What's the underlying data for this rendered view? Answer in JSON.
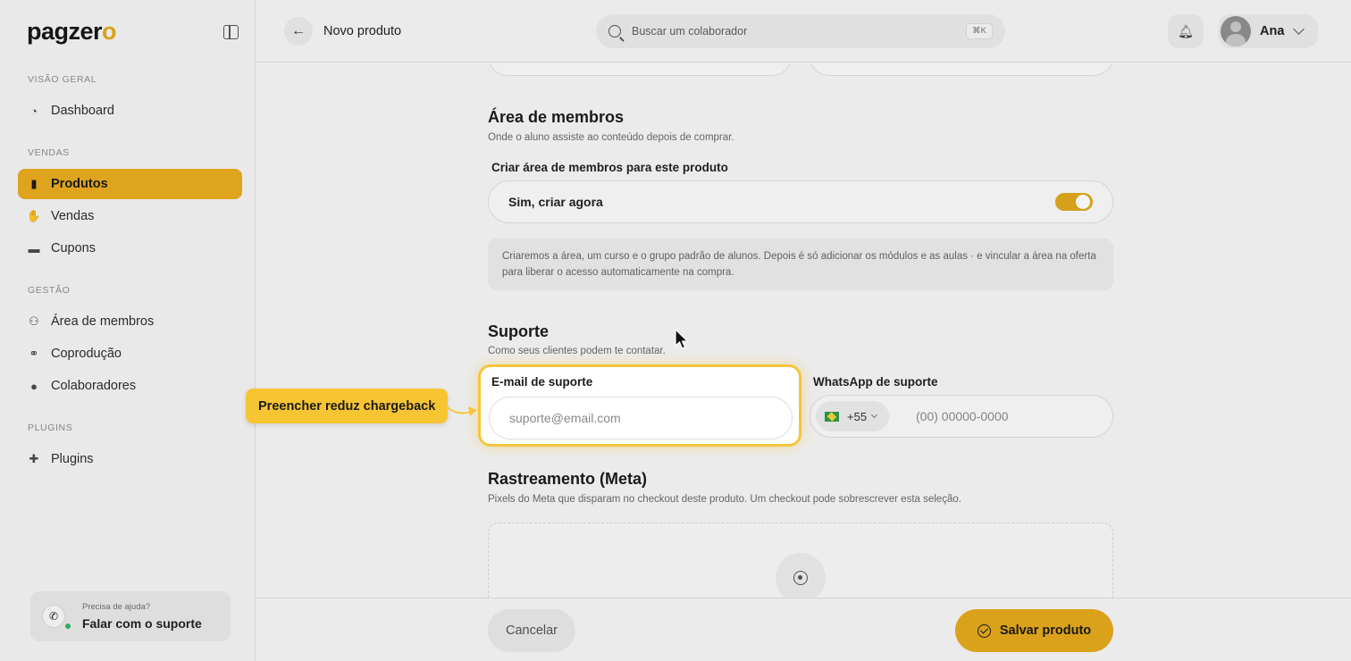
{
  "app": {
    "logo_text": "pagzer",
    "logo_accent": "o"
  },
  "sidebar": {
    "sections": [
      {
        "label": "VISÃO GERAL"
      },
      {
        "label": "VENDAS"
      },
      {
        "label": "GESTÃO"
      },
      {
        "label": "PLUGINS"
      }
    ],
    "items": [
      {
        "label": "Dashboard",
        "icon": "pie-chart-icon"
      },
      {
        "label": "Produtos",
        "icon": "box-icon",
        "active": true
      },
      {
        "label": "Vendas",
        "icon": "hand-money-icon"
      },
      {
        "label": "Cupons",
        "icon": "ticket-icon"
      },
      {
        "label": "Área de membros",
        "icon": "users-icon"
      },
      {
        "label": "Coprodução",
        "icon": "handshake-icon"
      },
      {
        "label": "Colaboradores",
        "icon": "user-icon"
      },
      {
        "label": "Plugins",
        "icon": "puzzle-icon"
      }
    ],
    "help": {
      "small": "Precisa de ajuda?",
      "title": "Falar com o suporte",
      "icon": "whatsapp-icon"
    }
  },
  "header": {
    "page_title": "Novo produto",
    "search_placeholder": "Buscar um colaborador",
    "search_shortcut": "⌘K",
    "user_name": "Ana"
  },
  "members": {
    "title": "Área de membros",
    "subtitle": "Onde o aluno assiste ao conteúdo depois de comprar.",
    "toggle_label": "Criar área de membros para este produto",
    "toggle_value": "Sim, criar agora",
    "toggle_on": true,
    "info": "Criaremos a área, um curso e o grupo padrão de alunos. Depois é só adicionar os módulos e as aulas · e vincular a área na oferta para liberar o acesso automaticamente na compra."
  },
  "support": {
    "title": "Suporte",
    "subtitle": "Como seus clientes podem te contatar.",
    "email_label": "E-mail de suporte",
    "email_placeholder": "suporte@email.com",
    "whatsapp_label": "WhatsApp de suporte",
    "country_code": "+55",
    "phone_placeholder": "(00) 00000-0000"
  },
  "tracking": {
    "title": "Rastreamento (Meta)",
    "subtitle": "Pixels do Meta que disparam no checkout deste produto. Um checkout pode sobrescrever esta seleção."
  },
  "footer": {
    "cancel": "Cancelar",
    "save": "Salvar produto"
  },
  "tour": {
    "tooltip": "Preencher reduz chargeback"
  },
  "colors": {
    "accent": "#e4a91c",
    "highlight": "#f5c53b"
  }
}
